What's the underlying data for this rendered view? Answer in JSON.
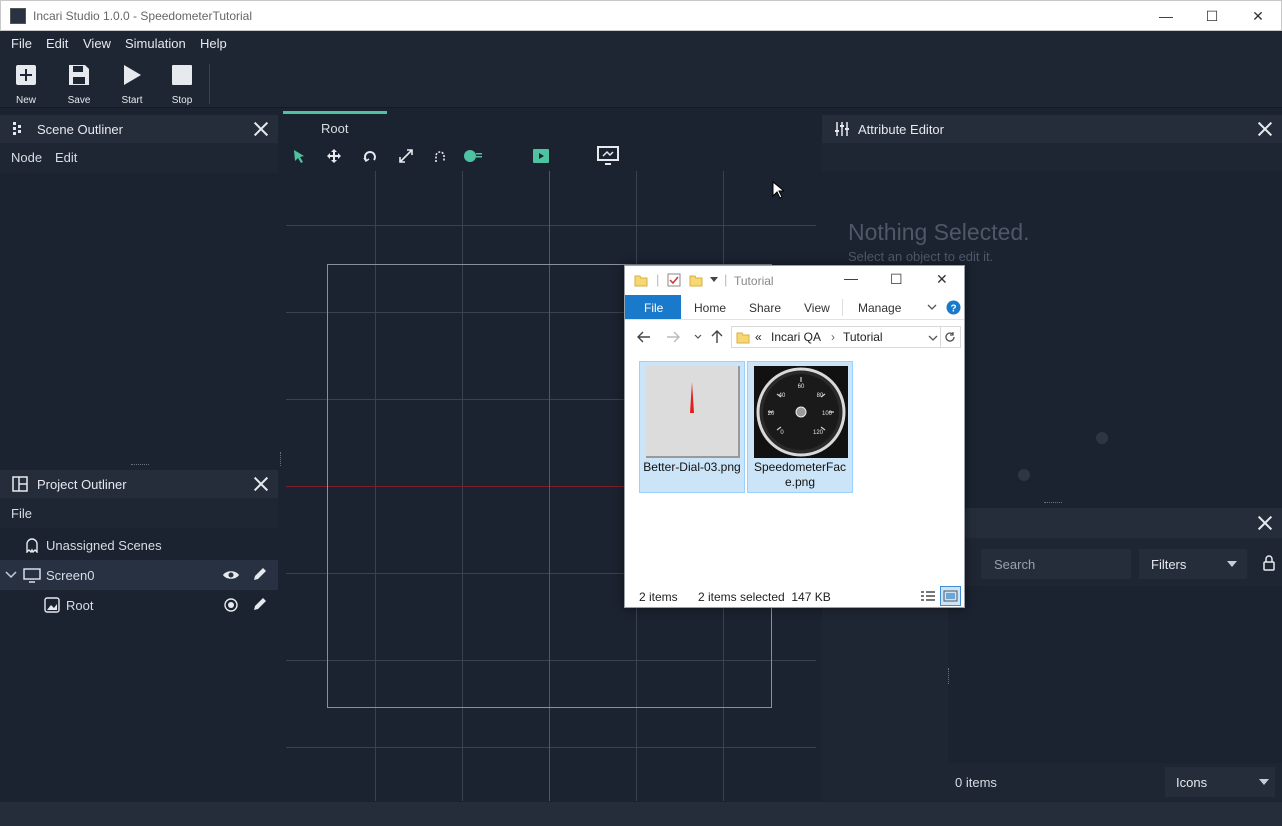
{
  "window": {
    "title": "Incari Studio 1.0.0 - SpeedometerTutorial",
    "minimize": "—",
    "maximize": "☐",
    "close": "✕"
  },
  "menu": [
    "File",
    "Edit",
    "View",
    "Simulation",
    "Help"
  ],
  "toolbar": {
    "new": "New",
    "save": "Save",
    "start": "Start",
    "stop": "Stop"
  },
  "scene_outliner": {
    "title": "Scene Outliner",
    "menu": [
      "Node",
      "Edit"
    ]
  },
  "project_outliner": {
    "title": "Project Outliner",
    "menu": [
      "File"
    ],
    "items": [
      {
        "label": "Unassigned Scenes"
      },
      {
        "label": "Screen0"
      },
      {
        "label": "Root"
      }
    ]
  },
  "viewport": {
    "tab": "Root"
  },
  "attribute_editor": {
    "title": "Attribute Editor",
    "empty_title": "Nothing Selected.",
    "empty_hint": "Select an object to edit it."
  },
  "asset_panel": {
    "search_placeholder": "Search",
    "filters": "Filters",
    "count": "0 items",
    "view_mode": "Icons"
  },
  "explorer": {
    "title": "Tutorial",
    "tabs": {
      "file": "File",
      "home": "Home",
      "share": "Share",
      "view": "View",
      "manage": "Manage"
    },
    "path": [
      "«",
      "Incari QA",
      "›",
      "Tutorial"
    ],
    "files": [
      {
        "name": "Better-Dial-03.png"
      },
      {
        "name": "SpeedometerFace.png"
      }
    ],
    "status_items": "2 items",
    "status_selected": "2 items selected  147 KB"
  },
  "dial": {
    "ticks": [
      "0",
      "20",
      "40",
      "60",
      "80",
      "100",
      "120"
    ]
  },
  "colors": {
    "accent": "#4fc3a1",
    "background": "#1b2230",
    "panel": "#252d3b",
    "explorer_file_tab": "#1979ca"
  }
}
